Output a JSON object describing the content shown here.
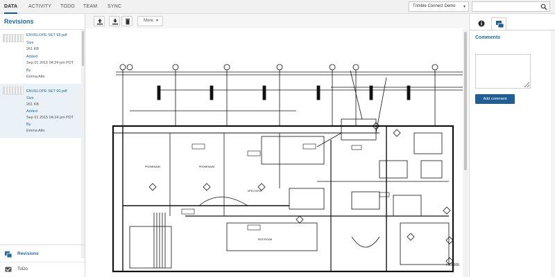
{
  "nav": {
    "tabs": [
      "DATA",
      "ACTIVITY",
      "TODO",
      "TEAM",
      "SYNC"
    ],
    "active": "DATA",
    "project_selector": "Trimble Connect Demo",
    "search_placeholder": ""
  },
  "revisions": {
    "title": "Revisions",
    "items": [
      {
        "file": "ENVELOPE SET 98.pdf",
        "size_label": "Size",
        "size": "261 KB",
        "added_label": "Added",
        "added": "Sep 01 2015 04:24 pm PDT",
        "by_label": "By",
        "by": "Emma Alto"
      },
      {
        "file": "ENVELOPE SET 90.pdf",
        "size_label": "Size",
        "size": "261 KB",
        "added_label": "Added",
        "added": "Sep 01 2015 04:24 pm PDT",
        "by_label": "By",
        "by": "Emma Alto"
      }
    ]
  },
  "left_nav": {
    "revisions": "Revisions",
    "todo": "ToDo"
  },
  "toolbar": {
    "upload_icon": "upload-icon",
    "download_icon": "download-icon",
    "delete_icon": "trash-icon",
    "more_label": "More"
  },
  "viewer": {
    "drawing_labels": [
      "PROMENADE",
      "PROMENADE",
      "SPECTATOR",
      "RESTROOM"
    ],
    "sheet_ref": "H25.306"
  },
  "comments": {
    "title": "Comments",
    "input_value": "",
    "add_label": "Add comment"
  },
  "colors": {
    "accent": "#1f6aa5",
    "button": "#1f5f96",
    "highlight": "#eaf2f8"
  }
}
